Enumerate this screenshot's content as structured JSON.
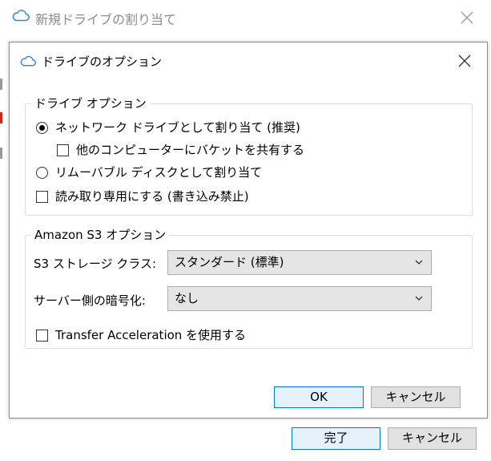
{
  "outer_window": {
    "title": "新規ドライブの割り当て",
    "done_label": "完了",
    "cancel_label": "キャンセル"
  },
  "dialog": {
    "title": "ドライブのオプション",
    "drive_options": {
      "legend": "ドライブ オプション",
      "network_drive_label": "ネットワーク ドライブとして割り当て (推奨)",
      "share_bucket_label": "他のコンピューターにバケットを共有する",
      "removable_disk_label": "リムーバブル ディスクとして割り当て",
      "read_only_label": "読み取り専用にする (書き込み禁止)",
      "selected": "network_drive"
    },
    "s3_options": {
      "legend": "Amazon S3 オプション",
      "storage_class_label": "S3 ストレージ クラス:",
      "storage_class_value": "スタンダード (標準)",
      "encryption_label": "サーバー側の暗号化:",
      "encryption_value": "なし",
      "transfer_acceleration_label": "Transfer Acceleration を使用する"
    },
    "ok_label": "OK",
    "cancel_label": "キャンセル"
  },
  "colors": {
    "accent": "#0078d7",
    "cloud_icon": "#3c8ad8",
    "strip_red": "#c42b1c"
  }
}
